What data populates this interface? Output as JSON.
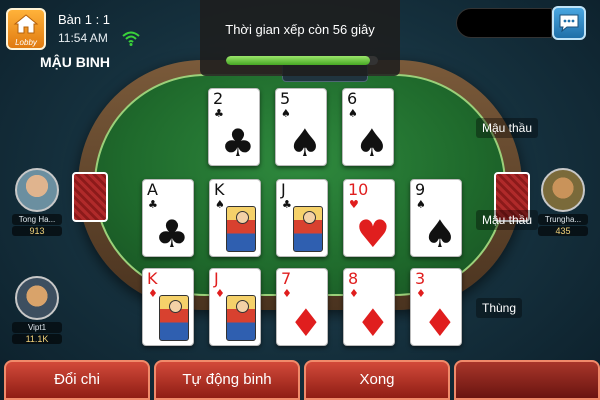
{
  "header": {
    "lobby_label": "Lobby",
    "room": "Bàn 1 : 1",
    "time": "11:54 AM",
    "game_title": "MẬU BINH"
  },
  "timer": {
    "text": "Thời gian xếp còn 56 giây",
    "progress": 0.95
  },
  "players": [
    {
      "name": "Tong Ha...",
      "chips": "913"
    },
    {
      "name": "Vipt1",
      "chips": "11.1K"
    },
    {
      "name": "Trungha...",
      "chips": "435"
    }
  ],
  "hands": {
    "top": [
      {
        "rank": "2",
        "suit": "♣",
        "color": "black"
      },
      {
        "rank": "5",
        "suit": "♠",
        "color": "black"
      },
      {
        "rank": "6",
        "suit": "♠",
        "color": "black"
      }
    ],
    "middle": [
      {
        "rank": "A",
        "suit": "♣",
        "color": "black"
      },
      {
        "rank": "K",
        "suit": "♠",
        "color": "black"
      },
      {
        "rank": "J",
        "suit": "♣",
        "color": "black"
      },
      {
        "rank": "10",
        "suit": "♥",
        "color": "red"
      },
      {
        "rank": "9",
        "suit": "♠",
        "color": "black"
      }
    ],
    "bottom": [
      {
        "rank": "K",
        "suit": "♦",
        "color": "red"
      },
      {
        "rank": "J",
        "suit": "♦",
        "color": "red"
      },
      {
        "rank": "7",
        "suit": "♦",
        "color": "red"
      },
      {
        "rank": "8",
        "suit": "♦",
        "color": "red"
      },
      {
        "rank": "3",
        "suit": "♦",
        "color": "red"
      }
    ]
  },
  "hand_labels": {
    "top": "Mậu thầu",
    "middle": "Mậu thầu",
    "bottom": "Thùng"
  },
  "buttons": {
    "swap": "Đổi chi",
    "auto": "Tự động binh",
    "done": "Xong",
    "extra": ""
  },
  "colors": {
    "felt": "#1f6a2c",
    "button": "#b02a20",
    "red_suit": "#e01e1e",
    "progress": "#6cc83e"
  }
}
